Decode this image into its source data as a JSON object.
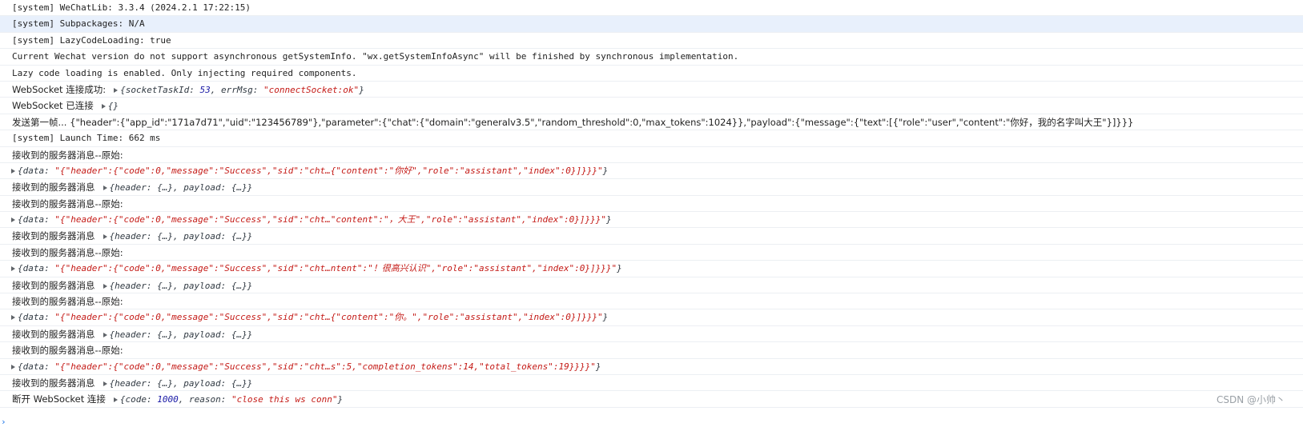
{
  "console": {
    "lines": [
      {
        "text": "[system] WeChatLib: 3.3.4 (2024.2.1 17:22:15)"
      },
      {
        "text": "[system] Subpackages: N/A"
      },
      {
        "text": "[system] LazyCodeLoading: true"
      },
      {
        "text": "Current Wechat version do not support asynchronous getSystemInfo. \"wx.getSystemInfoAsync\" will be finished by synchronous implementation."
      },
      {
        "text": "Lazy code loading is enabled. Only injecting required components."
      },
      {
        "label": "WebSocket 连接成功:",
        "obj": {
          "open": "{",
          "k1": "socketTaskId",
          "v1": "53",
          "sep": ", ",
          "k2": "errMsg",
          "v2": "\"connectSocket:ok\"",
          "close": "}"
        }
      },
      {
        "label": "WebSocket 已连接",
        "obj": "{}"
      },
      {
        "text": "发送第一帧... {\"header\":{\"app_id\":\"171a7d71\",\"uid\":\"123456789\"},\"parameter\":{\"chat\":{\"domain\":\"generalv3.5\",\"random_threshold\":0,\"max_tokens\":1024}},\"payload\":{\"message\":{\"text\":[{\"role\":\"user\",\"content\":\"你好，我的名字叫大王\"}]}}}"
      },
      {
        "text": "[system] Launch Time: 662 ms"
      },
      {
        "text": "接收到的服务器消息--原始:"
      },
      {
        "data_str": "\"{\"header\":{\"code\":0,\"message\":\"Success\",\"sid\":\"cht…{\"content\":\"你好\",\"role\":\"assistant\",\"index\":0}]}}}\""
      },
      {
        "label": "接收到的服务器消息",
        "summary": "{header: {…}, payload: {…}}"
      },
      {
        "text": "接收到的服务器消息--原始:"
      },
      {
        "data_str": "\"{\"header\":{\"code\":0,\"message\":\"Success\",\"sid\":\"cht…\"content\":\"，大王\",\"role\":\"assistant\",\"index\":0}]}}}\""
      },
      {
        "label": "接收到的服务器消息",
        "summary": "{header: {…}, payload: {…}}"
      },
      {
        "text": "接收到的服务器消息--原始:"
      },
      {
        "data_str": "\"{\"header\":{\"code\":0,\"message\":\"Success\",\"sid\":\"cht…ntent\":\"！很高兴认识\",\"role\":\"assistant\",\"index\":0}]}}}\""
      },
      {
        "label": "接收到的服务器消息",
        "summary": "{header: {…}, payload: {…}}"
      },
      {
        "text": "接收到的服务器消息--原始:"
      },
      {
        "data_str": "\"{\"header\":{\"code\":0,\"message\":\"Success\",\"sid\":\"cht…{\"content\":\"你。\",\"role\":\"assistant\",\"index\":0}]}}}\""
      },
      {
        "label": "接收到的服务器消息",
        "summary": "{header: {…}, payload: {…}}"
      },
      {
        "text": "接收到的服务器消息--原始:"
      },
      {
        "data_str": "\"{\"header\":{\"code\":0,\"message\":\"Success\",\"sid\":\"cht…s\":5,\"completion_tokens\":14,\"total_tokens\":19}}}}\""
      },
      {
        "label": "接收到的服务器消息",
        "summary": "{header: {…}, payload: {…}}"
      },
      {
        "label": "断开 WebSocket 连接",
        "obj": {
          "open": "{",
          "k1": "code",
          "v1": "1000",
          "sep": ", ",
          "k2": "reason",
          "v2": "\"close this ws conn\"",
          "close": "}"
        }
      }
    ],
    "data_key": "data",
    "watermark": "CSDN @小帅丶",
    "prompt_caret": "›"
  }
}
